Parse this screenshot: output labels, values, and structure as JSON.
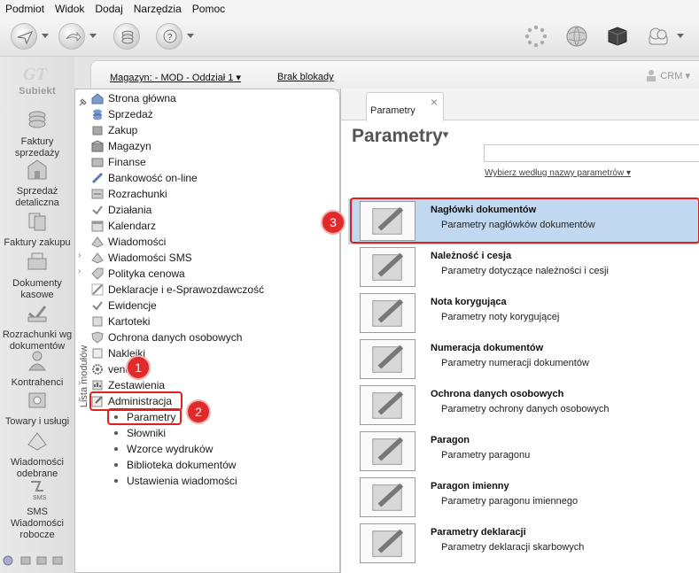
{
  "menubar": [
    "Podmiot",
    "Widok",
    "Dodaj",
    "Narzędzia",
    "Pomoc"
  ],
  "app": {
    "logo": "Subiekt",
    "items": [
      "Faktury sprzedaży",
      "Sprzedaż detaliczna",
      "Faktury zakupu",
      "Dokumenty kasowe",
      "Rozrachunki wg dokumentów",
      "Kontrahenci",
      "Towary i usługi",
      "Wiadomości odebrane",
      "SMS Wiadomości robocze"
    ],
    "sms_badge": "SMS"
  },
  "strip": {
    "magazyn": "Magazyn: - MOD - Oddział 1",
    "brak": "Brak blokady",
    "crm": "CRM"
  },
  "modules": {
    "vertical_label": "Lista modułów",
    "items": [
      "Strona główna",
      "Sprzedaż",
      "Zakup",
      "Magazyn",
      "Finanse",
      "Bankowość on-line",
      "Rozrachunki",
      "Działania",
      "Kalendarz",
      "Wiadomości",
      "Wiadomości SMS",
      "Polityka cenowa",
      "Deklaracje i e-Sprawozdawczość",
      "Ewidencje",
      "Kartoteki",
      "Ochrona danych osobowych",
      "Naklejki",
      "vendero",
      "Zestawienia",
      "Administracja"
    ],
    "subitems": [
      "Parametry",
      "Słowniki",
      "Wzorce wydruków",
      "Biblioteka dokumentów",
      "Ustawienia wiadomości"
    ]
  },
  "annotations": [
    "1",
    "2",
    "3"
  ],
  "content": {
    "tab_label": "Parametry",
    "tab_close": "×",
    "title": "Parametry",
    "search_placeholder": "",
    "search_hint": "Wybierz według nazwy parametrów",
    "rows": [
      {
        "title": "Nagłówki dokumentów",
        "desc": "Parametry nagłówków dokumentów"
      },
      {
        "title": "Należność i cesja",
        "desc": "Parametry dotyczące należności i cesji"
      },
      {
        "title": "Nota korygująca",
        "desc": "Parametry noty korygującej"
      },
      {
        "title": "Numeracja dokumentów",
        "desc": "Parametry numeracji dokumentów"
      },
      {
        "title": "Ochrona danych osobowych",
        "desc": "Parametry ochrony danych osobowych"
      },
      {
        "title": "Paragon",
        "desc": "Parametry paragonu"
      },
      {
        "title": "Paragon imienny",
        "desc": "Parametry paragonu imiennego"
      },
      {
        "title": "Parametry deklaracji",
        "desc": "Parametry deklaracji skarbowych"
      }
    ]
  },
  "colors": {
    "selected_row": "#c0d9f1",
    "annotation_red": "#e12a2a"
  }
}
